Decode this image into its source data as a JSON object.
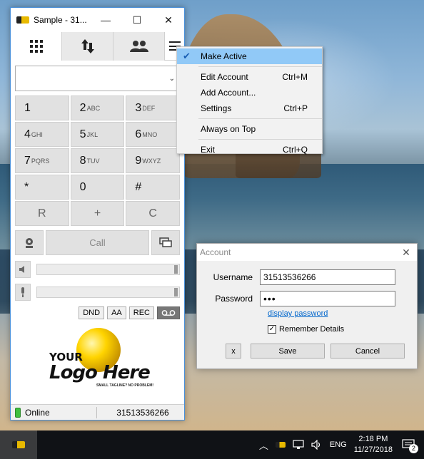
{
  "window": {
    "title": "Sample - 31..."
  },
  "titlebar_buttons": {
    "minimize": "—",
    "maximize": "☐",
    "close": "✕"
  },
  "tabs": [
    {
      "name": "dialpad",
      "icon": "dialpad-icon"
    },
    {
      "name": "transfer",
      "icon": "transfer-arrows-icon"
    },
    {
      "name": "contacts",
      "icon": "contacts-icon"
    }
  ],
  "number_input": {
    "value": "",
    "dropdown_glyph": "⌄"
  },
  "keypad": [
    {
      "digit": "1",
      "letters": ""
    },
    {
      "digit": "2",
      "letters": "ABC"
    },
    {
      "digit": "3",
      "letters": "DEF"
    },
    {
      "digit": "4",
      "letters": "GHI"
    },
    {
      "digit": "5",
      "letters": "JKL"
    },
    {
      "digit": "6",
      "letters": "MNO"
    },
    {
      "digit": "7",
      "letters": "PQRS"
    },
    {
      "digit": "8",
      "letters": "TUV"
    },
    {
      "digit": "9",
      "letters": "WXYZ"
    },
    {
      "digit": "*",
      "letters": ""
    },
    {
      "digit": "0",
      "letters": ""
    },
    {
      "digit": "#",
      "letters": ""
    }
  ],
  "actions": {
    "redial": "R",
    "plus": "+",
    "clear": "C"
  },
  "call": {
    "label": "Call"
  },
  "options": {
    "dnd": "DND",
    "aa": "AA",
    "rec": "REC"
  },
  "branding": {
    "your": "YOUR",
    "main": "Logo Here",
    "tagline": "SMALL TAGLINE? NO PROBLEM!"
  },
  "status": {
    "state": "Online",
    "account": "31513536266",
    "color": "#3fbf3f"
  },
  "menu": {
    "items": [
      {
        "label": "Make Active",
        "shortcut": "",
        "checked": true,
        "highlighted": true
      },
      {
        "label": "Edit Account",
        "shortcut": "Ctrl+M"
      },
      {
        "label": "Add Account...",
        "shortcut": ""
      },
      {
        "label": "Settings",
        "shortcut": "Ctrl+P"
      },
      {
        "label": "Always on Top",
        "shortcut": ""
      },
      {
        "label": "Exit",
        "shortcut": "Ctrl+Q"
      }
    ]
  },
  "dialog": {
    "title": "Account",
    "close": "✕",
    "username_label": "Username",
    "username_value": "31513536266",
    "password_label": "Password",
    "password_value": "•••",
    "show_password_link": "display password",
    "remember_label": "Remember Details",
    "remember_checked": true,
    "x_button": "x",
    "save_button": "Save",
    "cancel_button": "Cancel"
  },
  "taskbar": {
    "language": "ENG",
    "time": "2:18 PM",
    "date": "11/27/2018",
    "notification_count": "2"
  }
}
